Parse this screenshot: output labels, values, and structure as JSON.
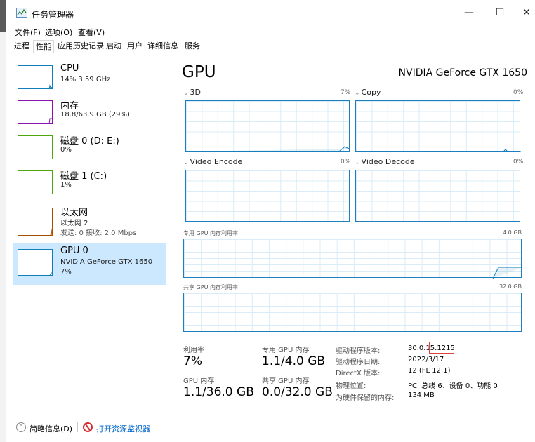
{
  "window": {
    "title": "任务管理器",
    "minimize": "—",
    "maximize": "☐",
    "close": "✕"
  },
  "menu": [
    "文件(F)",
    "选项(O)",
    "查看(V)"
  ],
  "tabs": [
    "进程",
    "性能",
    "应用历史记录",
    "启动",
    "用户",
    "详细信息",
    "服务"
  ],
  "sidebar": {
    "items": [
      {
        "title": "CPU",
        "sub1": "14% 3.59 GHz",
        "sub2": "",
        "color": "#117dbb"
      },
      {
        "title": "内存",
        "sub1": "18.8/63.9 GB (29%)",
        "sub2": "",
        "color": "#8b12ae"
      },
      {
        "title": "磁盘 0 (D: E:)",
        "sub1": "0%",
        "sub2": "",
        "color": "#4da60c"
      },
      {
        "title": "磁盘 1 (C:)",
        "sub1": "1%",
        "sub2": "",
        "color": "#4da60c"
      },
      {
        "title": "以太网",
        "sub1": "以太网 2",
        "sub2": "发送: 0 接收: 2.0 Mbps",
        "color": "#a74f01"
      },
      {
        "title": "GPU 0",
        "sub1": "NVIDIA GeForce GTX 1650",
        "sub2": "7%",
        "color": "#117dbb"
      }
    ]
  },
  "gpu": {
    "title": "GPU",
    "name": "NVIDIA GeForce GTX 1650",
    "engines": [
      {
        "label": "3D",
        "pct": "7%"
      },
      {
        "label": "Copy",
        "pct": "0%"
      },
      {
        "label": "Video Encode",
        "pct": "0%"
      },
      {
        "label": "Video Decode",
        "pct": "0%"
      }
    ],
    "dedicated_mem": {
      "label": "专用 GPU 内存利用率",
      "cap": "4.0 GB"
    },
    "shared_mem": {
      "label": "共享 GPU 内存利用率",
      "cap": "32.0 GB"
    }
  },
  "stats": {
    "util_label": "利用率",
    "util_value": "7%",
    "ded_label": "专用 GPU 内存",
    "ded_value": "1.1/4.0 GB",
    "gpumem_label": "GPU 内存",
    "gpumem_value": "1.1/36.0 GB",
    "shared_label": "共享 GPU 内存",
    "shared_value": "0.0/32.0 GB"
  },
  "info": [
    {
      "label": "驱动程序版本:",
      "value": "30.0.15.1215"
    },
    {
      "label": "驱动程序日期:",
      "value": "2022/3/17"
    },
    {
      "label": "DirectX 版本:",
      "value": "12 (FL 12.1)"
    },
    {
      "label": "物理位置:",
      "value": "PCI 总线 6、设备 0、功能 0"
    },
    {
      "label": "为硬件保留的内存:",
      "value": "134 MB"
    }
  ],
  "footer": {
    "brief": "简略信息(D)",
    "monitor": "打开资源监视器"
  },
  "colors": {
    "accent": "#117dbb",
    "selected_bg": "#cce8ff",
    "highlight": "#e04040"
  }
}
